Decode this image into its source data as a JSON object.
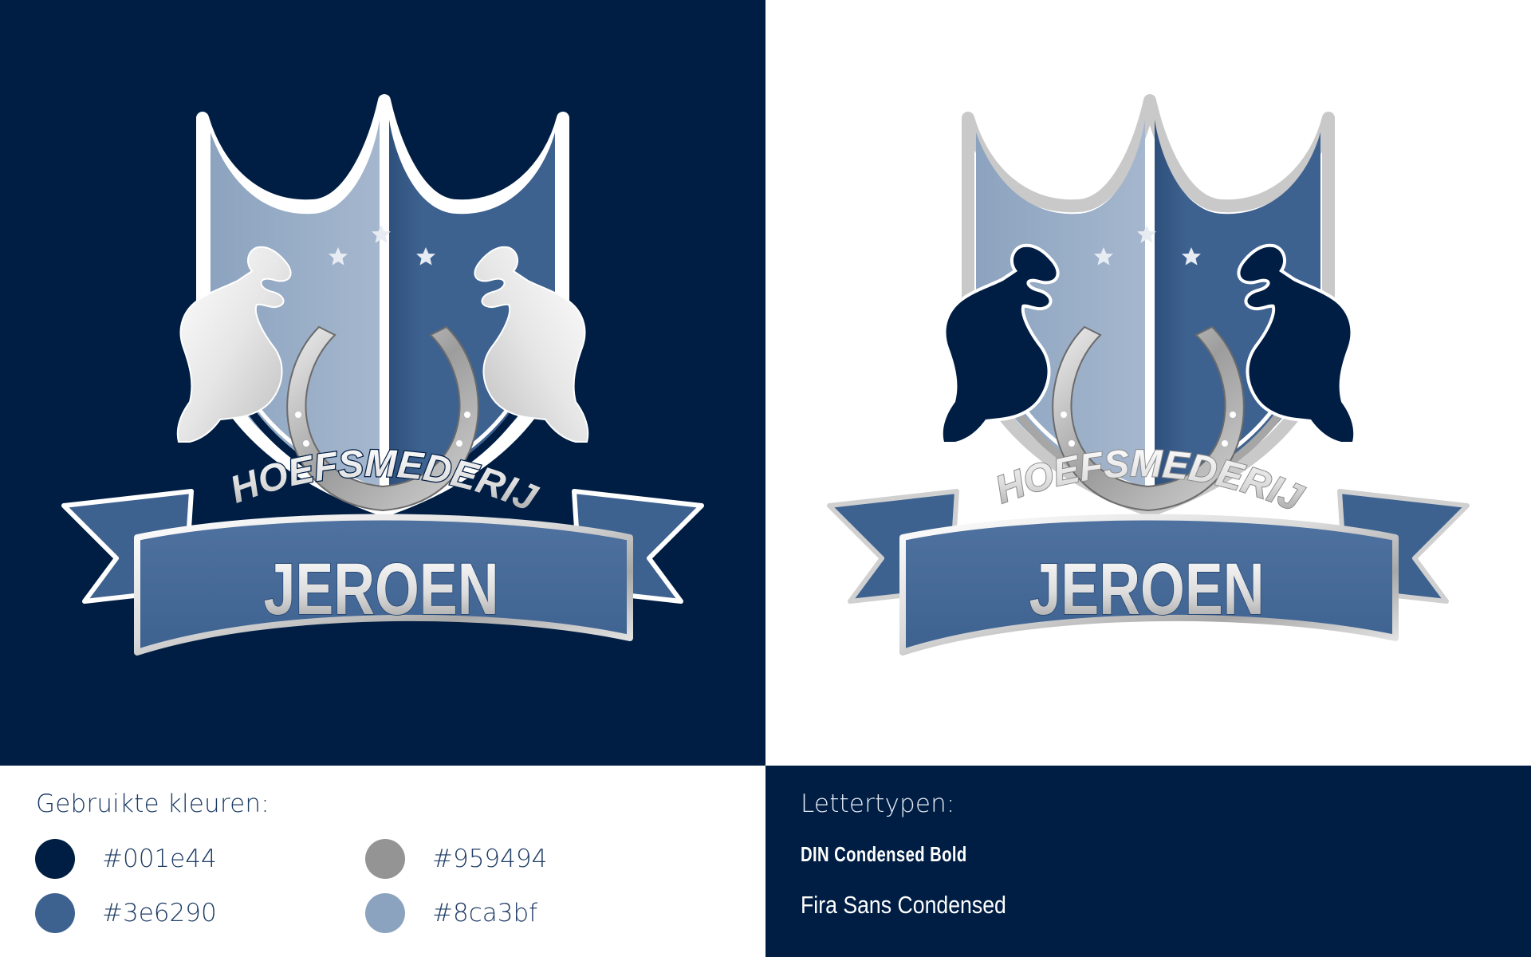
{
  "logo": {
    "top_text": "HOEFSMEDERIJ",
    "name_text": "JEROEN"
  },
  "colors_section": {
    "heading": "Gebruikte kleuren:",
    "swatches": [
      {
        "label": "#001e44",
        "color": "#001e44"
      },
      {
        "label": "#3e6290",
        "color": "#3e6290"
      },
      {
        "label": "#959494",
        "color": "#959494"
      },
      {
        "label": "#8ca3bf",
        "color": "#8ca3bf"
      }
    ]
  },
  "fonts_section": {
    "heading": "Lettertypen:",
    "fonts": [
      "DIN Condensed Bold",
      "Fira Sans Condensed"
    ]
  }
}
